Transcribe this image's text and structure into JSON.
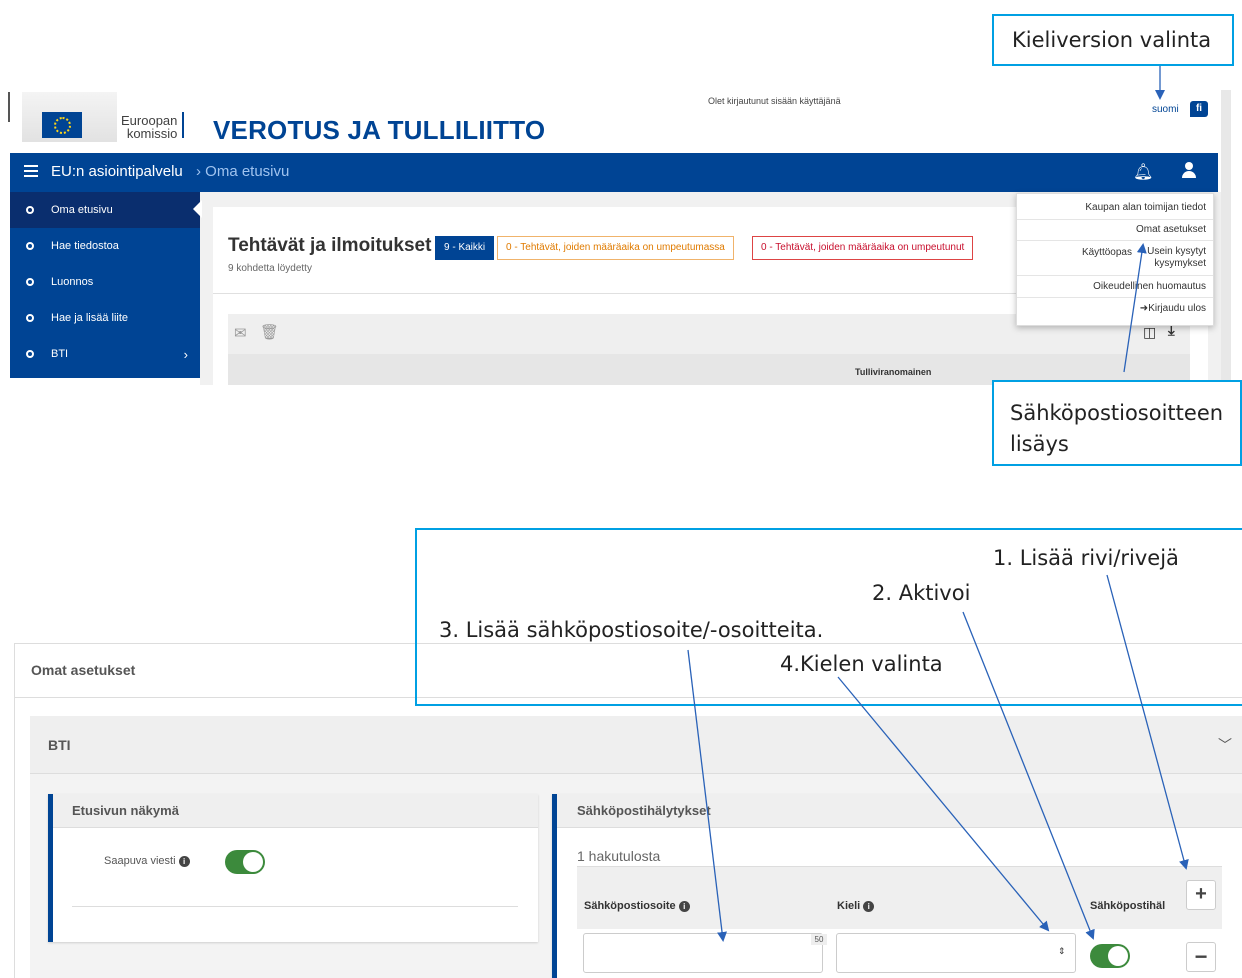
{
  "header": {
    "org_line1": "Euroopan",
    "org_line2": "komissio",
    "site_title": "VEROTUS JA TULLILIITTO",
    "logged_in": "Olet kirjautunut sisään käyttäjänä",
    "language": "suomi",
    "language_code": "fi"
  },
  "navbar": {
    "home": "EU:n asiointipalvelu",
    "breadcrumb": "› Oma etusivu"
  },
  "sidebar": {
    "items": [
      {
        "label": "Oma etusivu",
        "active": true
      },
      {
        "label": "Hae tiedostoa"
      },
      {
        "label": "Luonnos"
      },
      {
        "label": "Hae ja lisää liite"
      },
      {
        "label": "BTI",
        "chevron": "›"
      }
    ]
  },
  "tasks": {
    "title": "Tehtävät ja ilmoitukset",
    "subtitle": "9 kohdetta löydetty",
    "filters": {
      "all": "9 - Kaikki",
      "due": "0 - Tehtävät, joiden määräaika on umpeutumassa",
      "overdue": "0 - Tehtävät, joiden määräaika on umpeutunut"
    },
    "column_header": "Tulliviranomainen"
  },
  "user_menu": {
    "items": [
      "Kaupan alan toimijan tiedot",
      "Omat asetukset",
      "Käyttöopas",
      "Usein kysytyt kysymykset",
      "Oikeudellinen huomautus",
      "Kirjaudu ulos"
    ]
  },
  "callouts": {
    "language_choice": "Kieliversion valinta",
    "email_add_line1": "Sähköpostiosoitteen",
    "email_add_line2": "lisäys",
    "step1": "1. Lisää rivi/rivejä",
    "step2": "2. Aktivoi",
    "step3": "3. Lisää sähköpostiosoite/-osoitteita.",
    "step4": "4.Kielen valinta"
  },
  "settings": {
    "title": "Omat asetukset",
    "section": "BTI",
    "front_view": {
      "title": "Etusivun näkymä",
      "incoming_label": "Saapuva viesti",
      "incoming_enabled": true
    },
    "email_alerts": {
      "title": "Sähköpostihälytykset",
      "result_count": "1 hakutulosta",
      "col_email": "Sähköpostiosoite",
      "col_language": "Kieli",
      "col_alert": "Sähköpostihäl",
      "max_length": "50",
      "row_enabled": true
    }
  },
  "colors": {
    "brand_blue": "#004494",
    "callout_border": "#00a0e3",
    "toggle_on": "#3c8a3c",
    "overdue_red": "#c8102e",
    "due_orange": "#e07b00"
  }
}
